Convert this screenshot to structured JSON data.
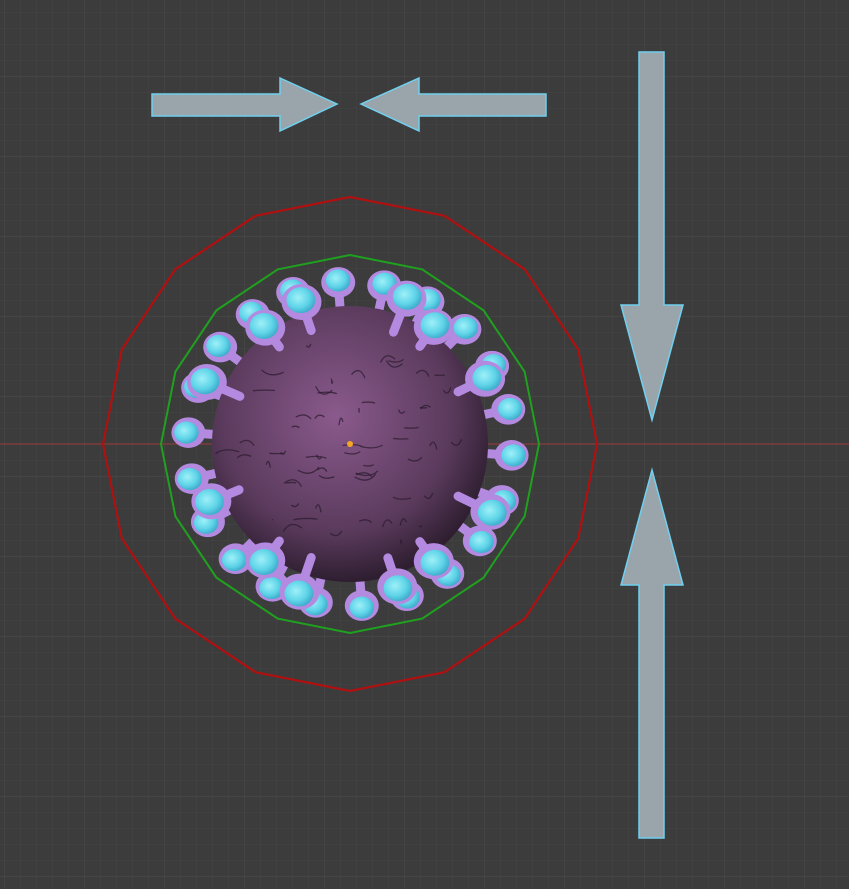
{
  "viewport": {
    "background_color": "#3c3c3c",
    "grid_minor_color": "#444444",
    "grid_major_color": "#4d4d4d",
    "x_axis_color": "#9b3a3a"
  },
  "arrows": {
    "fill_color": "#9aa5ab",
    "outline_color": "#6fd0f0",
    "items": [
      {
        "name": "arrow-right-icon",
        "direction": "right"
      },
      {
        "name": "arrow-left-icon",
        "direction": "left"
      },
      {
        "name": "arrow-down-icon",
        "direction": "down"
      },
      {
        "name": "arrow-up-icon",
        "direction": "up"
      }
    ]
  },
  "outer_ring": {
    "color": "#b01010",
    "sides": 16
  },
  "inner_ring": {
    "color": "#1fa01f",
    "sides": 16
  },
  "virus_model": {
    "body_color": "#5a3a5c",
    "spike_color": "#b48ae0",
    "spike_tip_color": "#5fd4e8",
    "origin_marker_color": "#f5a623"
  }
}
